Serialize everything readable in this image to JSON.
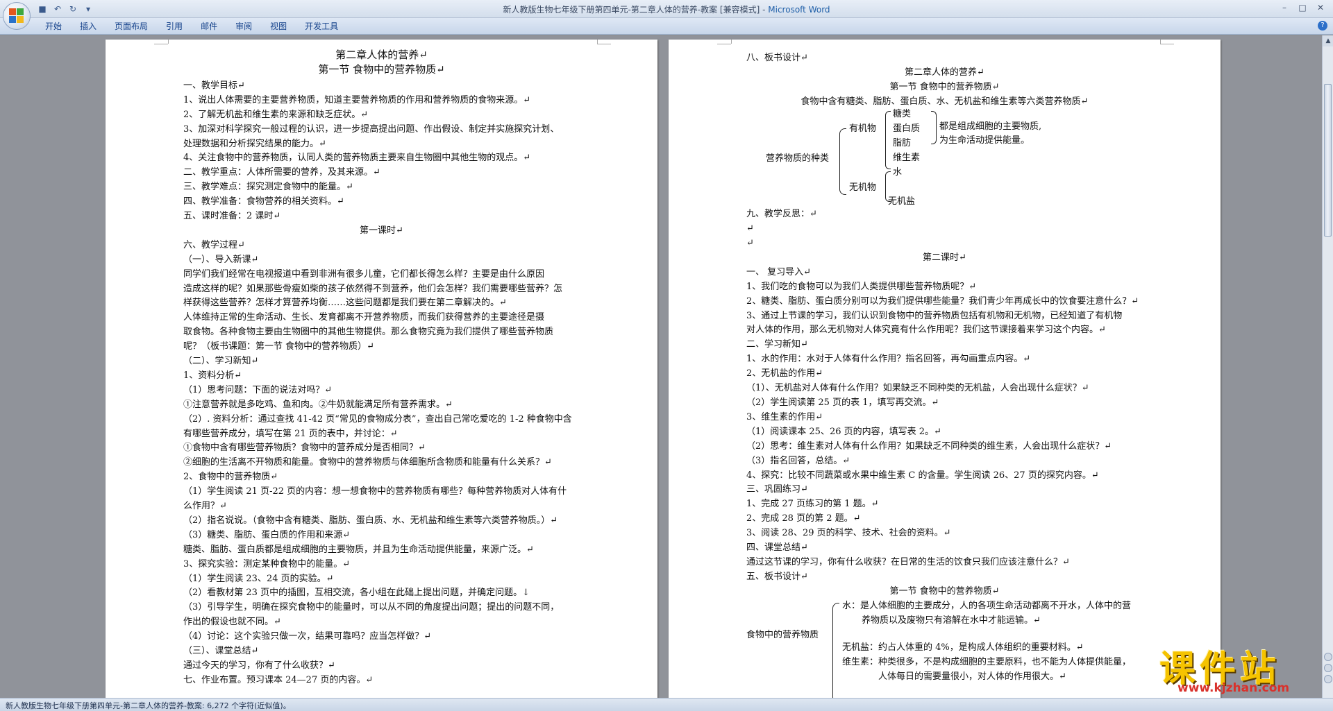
{
  "window": {
    "title": "新人教版生物七年级下册第四单元-第二章人体的营养-教案 [兼容模式] - ",
    "app_name": "Microsoft Word"
  },
  "ribbon": {
    "tabs": [
      "开始",
      "插入",
      "页面布局",
      "引用",
      "邮件",
      "审阅",
      "视图",
      "开发工具"
    ]
  },
  "status": {
    "text": "新人教版生物七年级下册第四单元-第二章人体的营养-教案: 6,272 个字符(近似值)。"
  },
  "watermark": {
    "main": "课件站",
    "url": "www.kjzhan.com"
  },
  "left_page": {
    "lines": [
      "第二章人体的营养↵",
      "第一节   食物中的营养物质↵",
      "一、教学目标↵",
      "1、说出人体需要的主要营养物质，知道主要营养物质的作用和营养物质的食物来源。↵",
      "2、了解无机盐和维生素的来源和缺乏症状。↵",
      " 3、加深对科学探究一般过程的认识，进一步提高提出问题、作出假设、制定并实施探究计划、",
      "处理数据和分析探究结果的能力。↵",
      " 4、关注食物中的营养物质，认同人类的营养物质主要来自生物圈中其他生物的观点。↵",
      "二、教学重点：人体所需要的营养，及其来源。↵",
      "三、教学难点：探究测定食物中的能量。↵",
      "四、教学准备：食物营养的相关资料。↵",
      "五、课时准备：2 课时↵",
      "第一课时↵",
      "六、教学过程↵",
      "（一）、导入新课↵",
      "    同学们我们经常在电视报道中看到非洲有很多儿童，它们都长得怎么样？主要是由什么原因",
      "造成这样的呢？如果那些骨瘦如柴的孩子依然得不到营养，他们会怎样？我们需要哪些营养？怎",
      "样获得这些营养？怎样才算营养均衡……这些问题都是我们要在第二章解决的。↵",
      "    人体维持正常的生命活动、生长、发育都离不开营养物质，而我们获得营养的主要途径是摄",
      "取食物。各种食物主要由生物圈中的其他生物提供。那么食物究竟为我们提供了哪些营养物质",
      "呢？（板书课题：第一节   食物中的营养物质）↵",
      "（二）、学习新知↵",
      "1、资料分析↵",
      "（1）思考问题：下面的说法对吗？↵",
      "①注意营养就是多吃鸡、鱼和肉。②牛奶就能满足所有营养需求。↵",
      "（2）. 资料分析：通过查找 41-42 页“常见的食物成分表”，查出自己常吃爱吃的 1-2 种食物中含",
      "有哪些营养成分，填写在第 21 页的表中，并讨论：↵",
      "①食物中含有哪些营养物质？食物中的营养成分是否相同？↵",
      "②细胞的生活离不开物质和能量。食物中的营养物质与体细胞所含物质和能量有什么关系？↵",
      "2、食物中的营养物质↵",
      "  （1）学生阅读 21 页-22 页的内容：想一想食物中的营养物质有哪些？每种营养物质对人体有什",
      "么作用？↵",
      "  （2）指名说说。（食物中含有糖类、脂肪、蛋白质、水、无机盐和维生素等六类营养物质。）↵",
      "（3）糖类、脂肪、蛋白质的作用和来源↵",
      "糖类、脂肪、蛋白质都是组成细胞的主要物质，并且为生命活动提供能量，来源广泛。↵",
      "3、探究实验：测定某种食物中的能量。↵",
      "（1）学生阅读 23、24 页的实验。↵",
      "（2）看教材第 23 页中的插图，互相交流，各小组在此础上提出问题，并确定问题。↓",
      "（3）引导学生，明确在探究食物中的能量时，可以从不同的角度提出问题；提出的问题不同，",
      "作出的假设也就不同。↵",
      "（4）讨论：这个实验只做一次，结果可靠吗？应当怎样做？↵",
      "（三）、课堂总结↵",
      "    通过今天的学习，你有了什么收获？↵",
      "七、作业布置。预习课本 24—27 页的内容。↵"
    ]
  },
  "right_page": {
    "lines_top": [
      "八、板书设计↵",
      "第二章人体的营养↵",
      "第一节   食物中的营养物质↵",
      "食物中含有糖类、脂肪、蛋白质、水、无机盐和维生素等六类营养物质↵"
    ],
    "diagram1": {
      "root": "营养物质的种类",
      "organic": "有机物",
      "inorganic": "无机物",
      "sugar": "糖类",
      "protein": "蛋白质",
      "fat": "脂肪",
      "vitamin": "维生素",
      "water": "水",
      "salt": "无机盐",
      "note1": "都是组成细胞的主要物质,",
      "note2": "为生命活动提供能量。"
    },
    "lines_mid": [
      "九、教学反思：↵",
      "↵",
      "↵",
      "第二课时↵",
      "一、  复习导入↵",
      "1、我们吃的食物可以为我们人类提供哪些营养物质呢？↵",
      "2、糖类、脂肪、蛋白质分别可以为我们提供哪些能量？我们青少年再成长中的饮食要注意什么？↵",
      "3、通过上节课的学习，我们认识到食物中的营养物质包括有机物和无机物，已经知道了有机物",
      "对人体的作用，那么无机物对人体究竟有什么作用呢？我们这节课接着来学习这个内容。↵",
      "二、学习新知↵",
      "1、水的作用：水对于人体有什么作用？指名回答，再勾画重点内容。↵",
      "2、无机盐的作用↵",
      "（1）、无机盐对人体有什么作用？如果缺乏不同种类的无机盐，人会出现什么症状？↵",
      "（2）学生阅读第 25 页的表 1，填写再交流。↵",
      "3、维生素的作用↵",
      "（1）阅读课本 25、26 页的内容，填写表 2。↵",
      "（2）思考：维生素对人体有什么作用？如果缺乏不同种类的维生素，人会出现什么症状？↵",
      "（3）指名回答，总结。↵",
      "4、探究：比较不同蔬菜或水果中维生素 C 的含量。学生阅读 26、27 页的探究内容。↵",
      "三、巩固练习↵",
      "1、完成 27 页练习的第 1 题。↵",
      "2、完成 28 页的第 2 题。↵",
      "3、阅读 28、29 页的科学、技术、社会的资料。↵",
      "四、课堂总结↵",
      "   通过这节课的学习，你有什么收获？在日常的生活的饮食只我们应该注意什么？↵",
      "五、板书设计↵",
      "第一节   食物中的营养物质↵"
    ],
    "diagram2": {
      "root": "食物中的营养物质",
      "water1": "水：是人体细胞的主要成分，人的各项生命活动都离不开水，人体中的营",
      "water2": "养物质以及废物只有溶解在水中才能运输。↵",
      "salt": "无机盐：约占人体重的 4%，是构成人体组织的重要材料。↵",
      "vit1": "维生素：种类很多，不是构成细胞的主要原料，也不能为人体提供能量，",
      "vit2": "人体每日的需要量很小，对人体的作用很大。↵"
    }
  }
}
